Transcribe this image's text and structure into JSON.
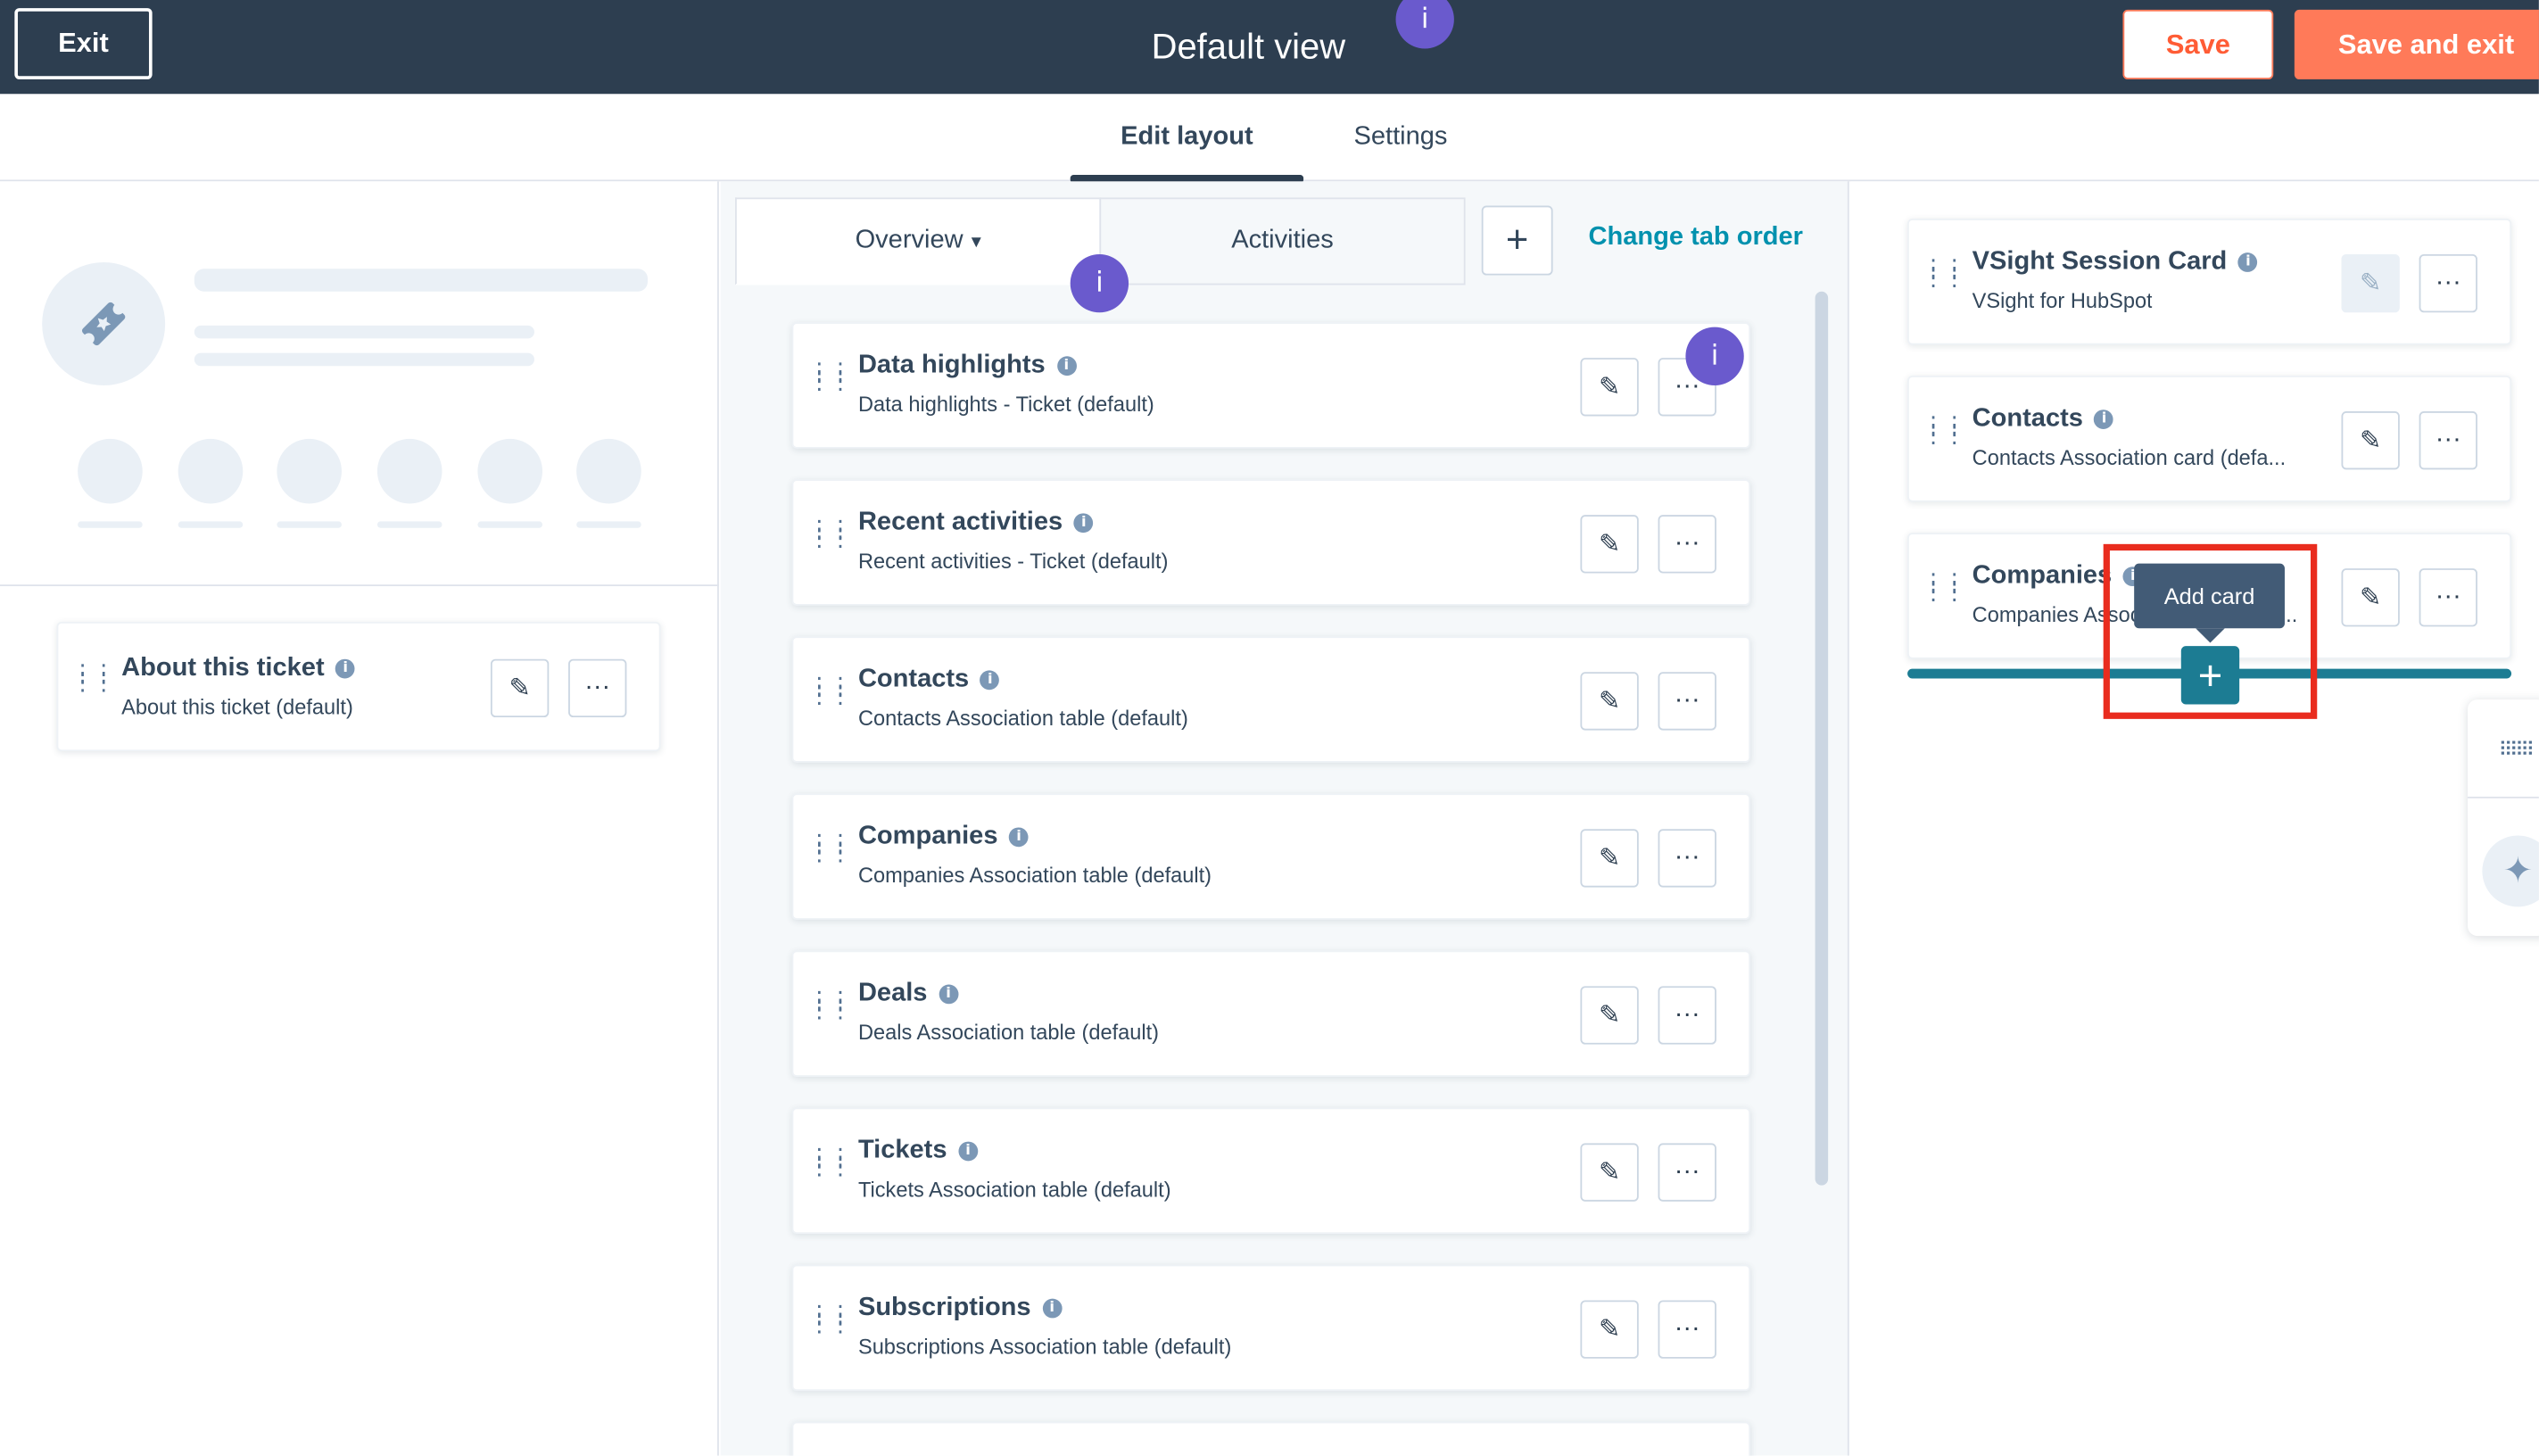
{
  "header": {
    "exit_label": "Exit",
    "title": "Default view",
    "info_marker": "i",
    "save_label": "Save",
    "save_exit_label": "Save and exit"
  },
  "page_tabs": [
    {
      "label": "Edit layout",
      "active": true
    },
    {
      "label": "Settings",
      "active": false
    }
  ],
  "left": {
    "card": {
      "title": "About this ticket",
      "subtitle": "About this ticket (default)"
    }
  },
  "middle": {
    "tabs": [
      {
        "label": "Overview",
        "caret": "▾",
        "active": true
      },
      {
        "label": "Activities",
        "active": false
      }
    ],
    "add_tab_symbol": "+",
    "change_tab_order": "Change tab order",
    "cards": [
      {
        "title": "Data highlights",
        "subtitle": "Data highlights - Ticket (default)"
      },
      {
        "title": "Recent activities",
        "subtitle": "Recent activities - Ticket (default)"
      },
      {
        "title": "Contacts",
        "subtitle": "Contacts Association table (default)"
      },
      {
        "title": "Companies",
        "subtitle": "Companies Association table (default)"
      },
      {
        "title": "Deals",
        "subtitle": "Deals Association table (default)"
      },
      {
        "title": "Tickets",
        "subtitle": "Tickets Association table (default)"
      },
      {
        "title": "Subscriptions",
        "subtitle": "Subscriptions Association table (default)"
      }
    ]
  },
  "right": {
    "cards": [
      {
        "title": "VSight Session Card",
        "subtitle": "VSight for HubSpot",
        "edit_disabled": true
      },
      {
        "title": "Contacts",
        "subtitle": "Contacts Association card (defa...",
        "edit_disabled": false
      },
      {
        "title": "Companies",
        "subtitle": "Companies Association card (def...",
        "edit_disabled": false
      }
    ],
    "tooltip": "Add card",
    "add_symbol": "+"
  },
  "icons": {
    "edit": "pencil-icon",
    "more": "more-dots-icon",
    "info": "info-icon",
    "drag": "drag-handle-icon",
    "ticket": "ticket-icon",
    "sparkle": "sparkle-icon"
  },
  "colors": {
    "header_bg": "#2d3e50",
    "accent_orange": "#ff7a59",
    "link_teal": "#0091ae",
    "drop_teal": "#1c7c93",
    "info_purple": "#6a5acd",
    "highlight_red": "#e92c1e"
  }
}
